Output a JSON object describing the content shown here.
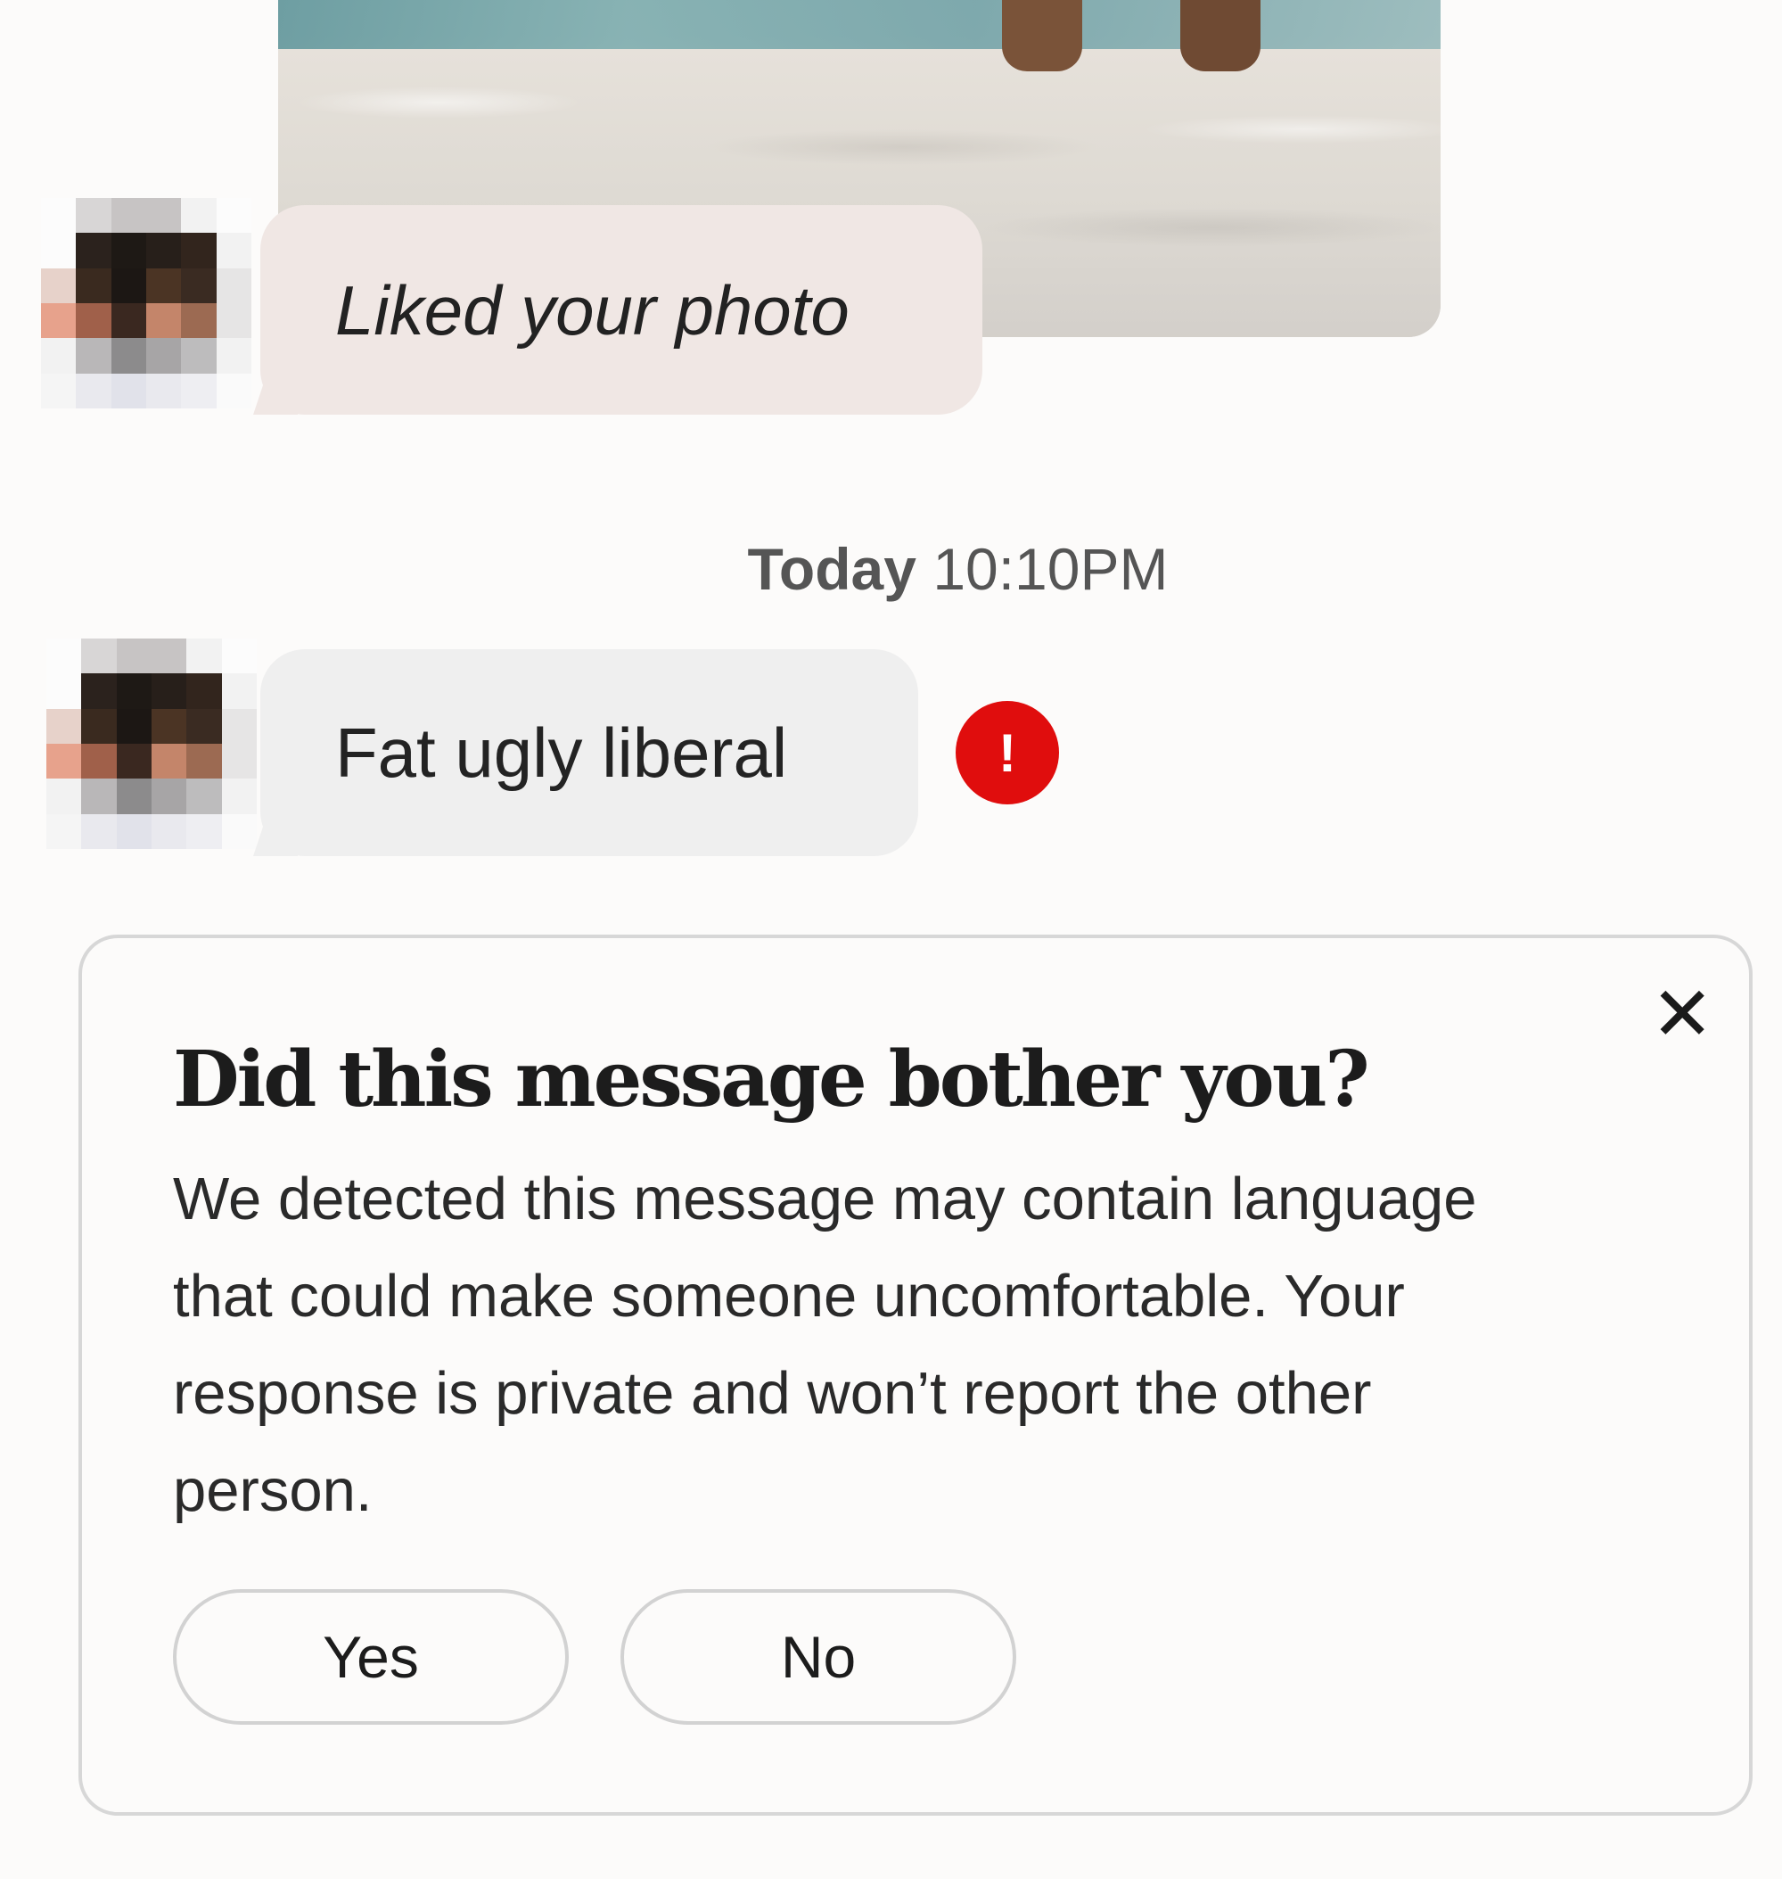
{
  "conversation": {
    "liked_message": "Liked your photo",
    "timestamp_day": "Today",
    "timestamp_time": "10:10PM",
    "received_message": "Fat ugly liberal",
    "alert_symbol": "!"
  },
  "feedback_card": {
    "title": "Did this message bother you?",
    "body": "We detected this message may contain language that could make someone uncomfortable. Your response is private and won’t report the other person.",
    "yes_label": "Yes",
    "no_label": "No",
    "close_symbol": "✕"
  },
  "colors": {
    "alert_red": "#e00d0d",
    "liked_bubble": "#f0e7e4",
    "message_bubble": "#efefef",
    "card_border": "#d7d7d7"
  }
}
